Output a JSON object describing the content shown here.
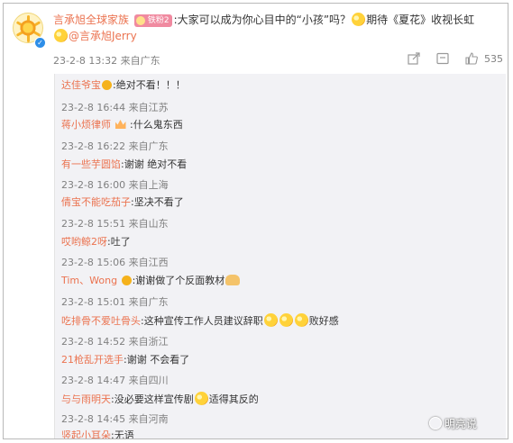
{
  "post": {
    "author": "言承旭全球家族",
    "fan_badge": "铁粉2",
    "text_1": ":大家可以成为你心目中的“小孩”吗？",
    "text_2": "期待《夏花》收视长虹",
    "mention": "@言承旭Jerry",
    "time": "23-2-8 13:32",
    "location": "来自广东",
    "likes": "535"
  },
  "icons": {
    "share": "share-icon",
    "comment": "comment-icon",
    "like": "thumbs-up-icon",
    "verified": "verified-badge-icon"
  },
  "replies": [
    {
      "name": "达佳爷宝",
      "text": ":绝对不看！！！",
      "time": "23-2-8 16:44",
      "location": "来自江苏"
    },
    {
      "name": "蒋小烦律师",
      "text": ":什么鬼东西",
      "time": "23-2-8 16:22",
      "location": "来自广东"
    },
    {
      "name": "有一些芋圆馅",
      "text": ":谢谢 绝对不看",
      "time": "23-2-8 16:00",
      "location": "来自上海"
    },
    {
      "name": "倩宝不能吃茄子",
      "text": ":坚决不看了",
      "time": "23-2-8 15:51",
      "location": "来自山东"
    },
    {
      "name": "哎哟鲸2呀",
      "text": ":吐了",
      "time": "23-2-8 15:06",
      "location": "来自江西"
    },
    {
      "name": "Tim、Wong",
      "text": ":谢谢做了个反面教材",
      "time": "23-2-8 15:01",
      "location": "来自广东"
    },
    {
      "name": "吃排骨不爱吐骨头",
      "text": ":这种宣传工作人员建议辞职",
      "text_2": "败好感",
      "time": "23-2-8 14:52",
      "location": "来自浙江"
    },
    {
      "name": "21枪乱开选手",
      "text": ":谢谢 不会看了",
      "time": "23-2-8 14:47",
      "location": "来自四川"
    },
    {
      "name": "与与雨明天",
      "text": ":没必要这样宣传剧",
      "text_2": "适得其反的",
      "time": "23-2-8 14:45",
      "location": "来自河南"
    },
    {
      "name": "竖起小耳朵",
      "text": ":无语"
    }
  ],
  "watermark": "明亮说",
  "colors": {
    "username": "#eb7350",
    "meta": "#808080",
    "reply_bg": "#f2f2f5"
  }
}
